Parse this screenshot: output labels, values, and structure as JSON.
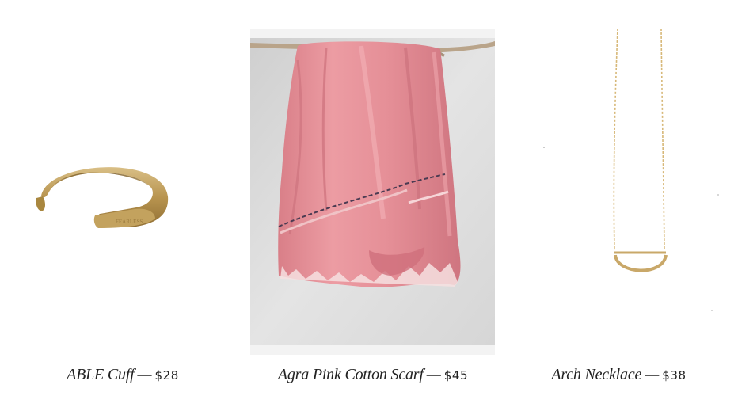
{
  "products": [
    {
      "title": "ABLE Cuff",
      "separator": "—",
      "price": "$28",
      "image": "gold-cuff-bracelet"
    },
    {
      "title": "Agra Pink Cotton Scarf",
      "separator": "—",
      "price": "$45",
      "image": "pink-scarf-on-branch"
    },
    {
      "title": "Arch Necklace",
      "separator": "—",
      "price": "$38",
      "image": "gold-arch-pendant-necklace"
    }
  ],
  "colors": {
    "gold": "#c9a869",
    "scarf_pink": "#e79aa0",
    "photo_bg": "#dcdcdc",
    "text": "#222222"
  }
}
